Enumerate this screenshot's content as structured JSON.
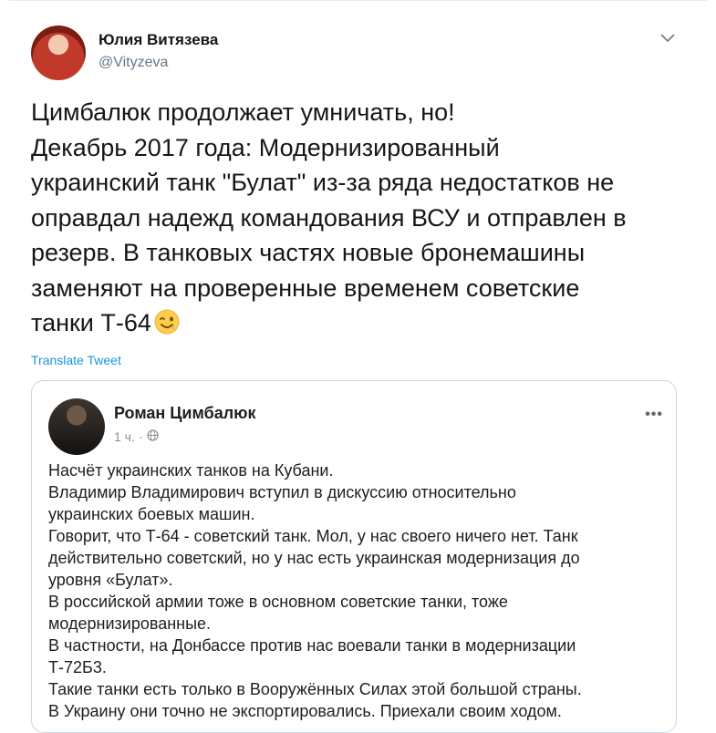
{
  "tweet": {
    "author_name": "Юлия Витязева",
    "author_handle": "@Vityzeva",
    "body_lines": [
      "Цимбалюк продолжает умничать, но!",
      "Декабрь 2017 года: Модернизированный",
      "украинский танк \"Булат\" из-за ряда недостатков не",
      "оправдал надежд командования ВСУ и отправлен в",
      "резерв. В танковых частях новые бронемашины",
      "заменяют на проверенные временем советские",
      "танки Т-64"
    ],
    "translate_label": "Translate Tweet",
    "menu_icon": "chevron-down-icon",
    "emoji_icon": "winking-face-emoji"
  },
  "embedded_post": {
    "author_name": "Роман Цимбалюк",
    "time": "1 ч.",
    "separator": "·",
    "privacy_icon": "globe-icon",
    "more_label": "•••",
    "body_lines": [
      "Насчёт украинских танков на Кубани.",
      "Владимир Владимирович вступил в дискуссию относительно",
      "украинских боевых машин.",
      "Говорит, что Т-64 - советский танк. Мол, у нас своего ничего нет. Танк",
      "действительно советский, но у нас есть украинская модернизация до",
      "уровня «Булат».",
      "В российской армии тоже в основном советские танки,  тоже",
      "модернизированные.",
      "В частности, на Донбассе против нас воевали танки в модернизации",
      "Т-72Б3.",
      "Такие танки есть только в Вооружённых Силах этой большой страны.",
      "В Украину они точно не экспортировались. Приехали своим ходом."
    ]
  },
  "colors": {
    "link": "#1b95e0",
    "secondary_text": "#657786",
    "border": "#ccd6dd"
  }
}
